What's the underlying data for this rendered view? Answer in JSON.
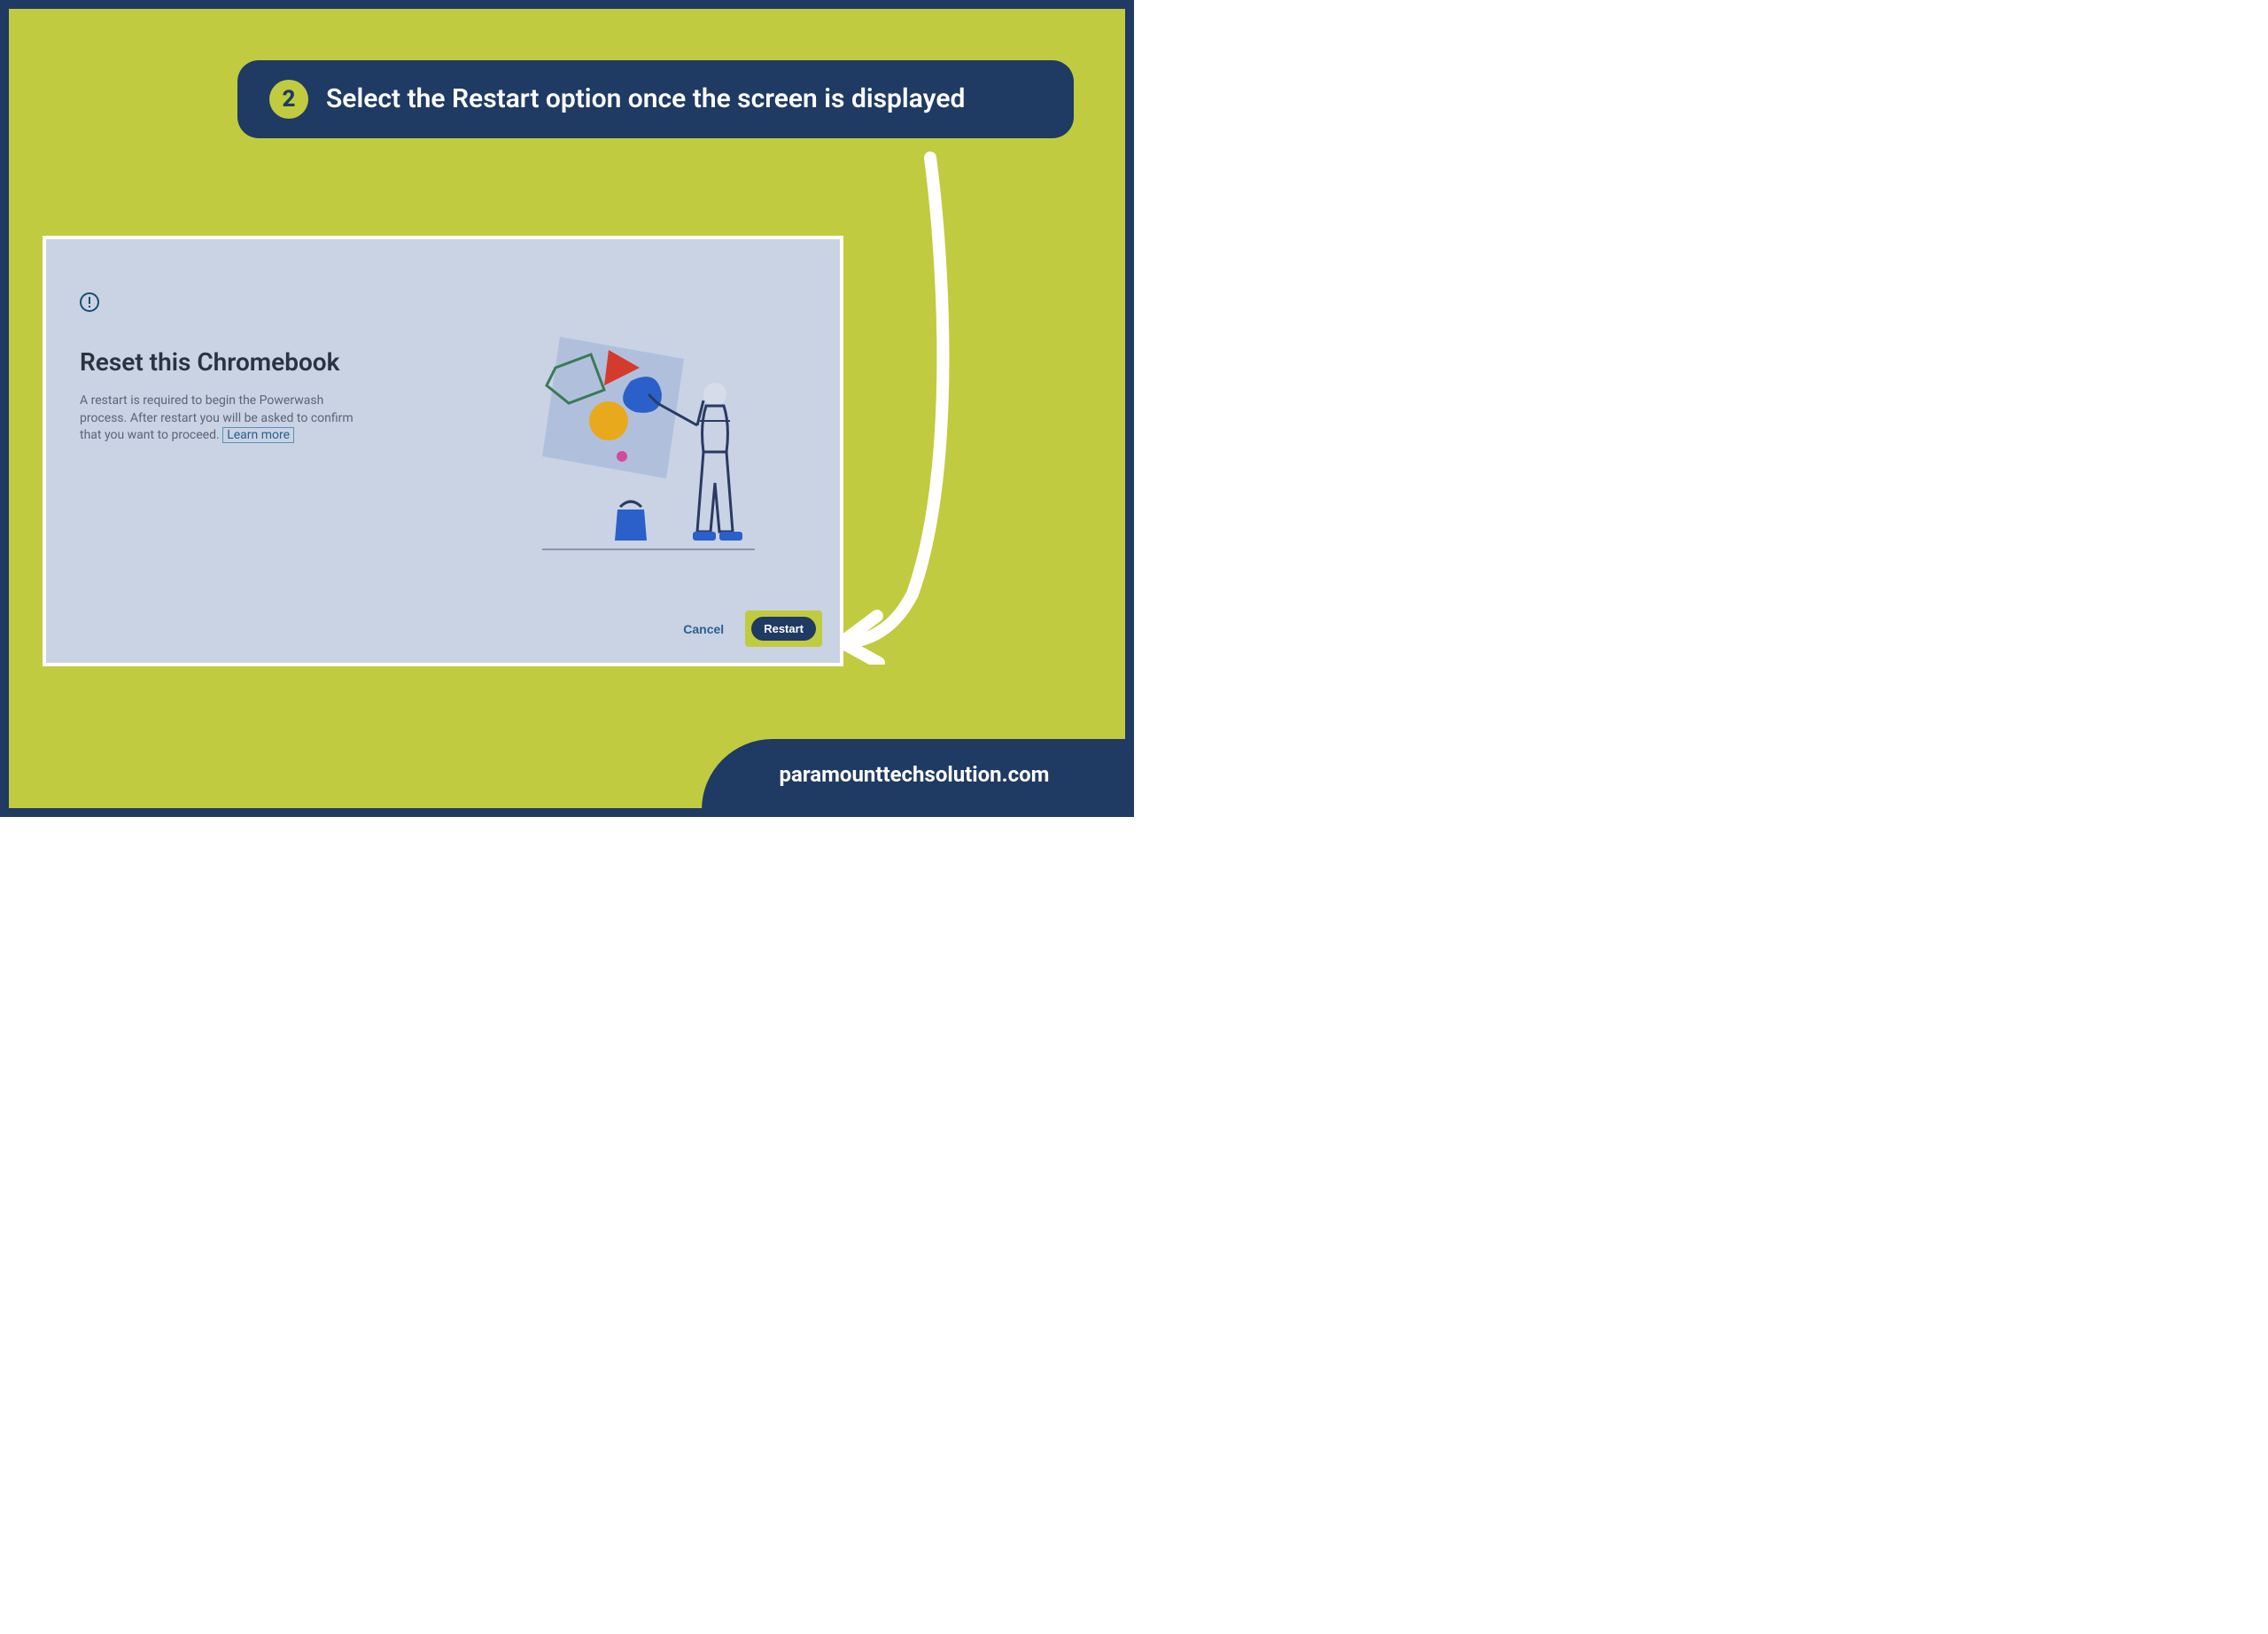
{
  "instruction": {
    "step_number": "2",
    "text": "Select the Restart option once the screen is displayed"
  },
  "dialog": {
    "title": "Reset this Chromebook",
    "body_line1": "A restart is required to begin the Powerwash process.",
    "body_line2_prefix": "After restart you will be asked to confirm that you want to proceed.",
    "learn_more": "Learn more",
    "cancel": "Cancel",
    "restart": "Restart"
  },
  "footer": {
    "site": "paramounttechsolution.com"
  }
}
